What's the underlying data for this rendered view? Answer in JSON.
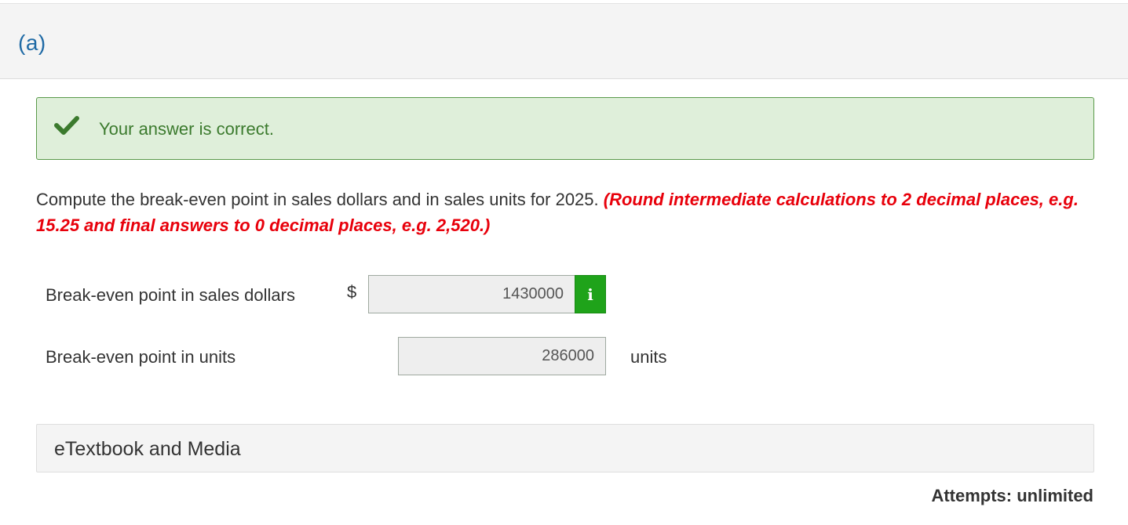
{
  "part": {
    "label": "(a)"
  },
  "alert": {
    "message": "Your answer is correct.",
    "icon": "checkmark-icon",
    "color": "#3b7a2d"
  },
  "question": {
    "text": "Compute the break-even point in sales dollars and in sales units for 2025. ",
    "hint": "(Round intermediate calculations to 2 decimal places, e.g. 15.25 and final answers to 0 decimal places, e.g. 2,520.)"
  },
  "fields": {
    "sales_dollars": {
      "label": "Break-even point in sales dollars",
      "currency": "$",
      "value": "1430000",
      "info_icon": "i"
    },
    "units": {
      "label": "Break-even point in units",
      "value": "286000",
      "unit": "units"
    }
  },
  "media": {
    "label": "eTextbook and Media"
  },
  "attempts": {
    "label": "Attempts: unlimited"
  }
}
